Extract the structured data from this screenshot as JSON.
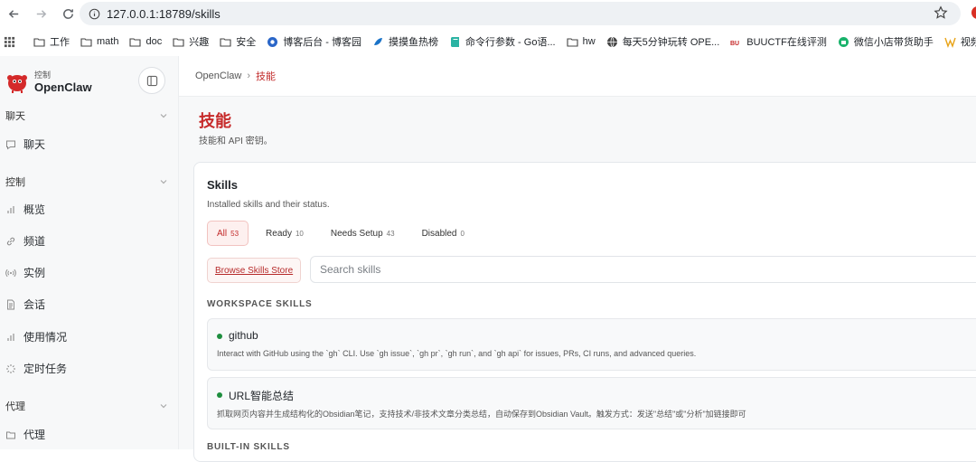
{
  "browser": {
    "url": "127.0.0.1:18789/skills",
    "bookmarks": [
      {
        "label": "工作",
        "icon": "folder-icon"
      },
      {
        "label": "math",
        "icon": "folder-icon"
      },
      {
        "label": "doc",
        "icon": "folder-icon"
      },
      {
        "label": "兴趣",
        "icon": "folder-icon"
      },
      {
        "label": "安全",
        "icon": "folder-icon"
      },
      {
        "label": "博客后台 - 博客园",
        "icon": "blog-icon"
      },
      {
        "label": "摸摸鱼热榜",
        "icon": "fish-icon"
      },
      {
        "label": "命令行参数 - Go语...",
        "icon": "book-icon"
      },
      {
        "label": "hw",
        "icon": "folder-icon"
      },
      {
        "label": "每天5分钟玩转 OPE...",
        "icon": "globe-icon"
      },
      {
        "label": "BUUCTF在线评测",
        "icon": "ctf-icon"
      },
      {
        "label": "微信小店带货助手",
        "icon": "shop-icon"
      },
      {
        "label": "视频号助手",
        "icon": "video-icon"
      }
    ]
  },
  "brand": {
    "small": "控制",
    "name": "OpenClaw"
  },
  "sidebar": {
    "groups": [
      {
        "label": "聊天",
        "items": [
          {
            "label": "聊天",
            "icon": "chat-icon"
          }
        ]
      },
      {
        "label": "控制",
        "items": [
          {
            "label": "概览",
            "icon": "bar-chart-icon"
          },
          {
            "label": "频道",
            "icon": "link-icon"
          },
          {
            "label": "实例",
            "icon": "broadcast-icon"
          },
          {
            "label": "会话",
            "icon": "document-icon"
          },
          {
            "label": "使用情况",
            "icon": "bar-chart-icon"
          },
          {
            "label": "定时任务",
            "icon": "loader-icon"
          }
        ]
      },
      {
        "label": "代理",
        "items": [
          {
            "label": "代理",
            "icon": "folder-icon"
          }
        ]
      }
    ]
  },
  "breadcrumb": {
    "home": "OpenClaw",
    "sep": "›",
    "current": "技能"
  },
  "page": {
    "title": "技能",
    "subtitle": "技能和 API 密钥。"
  },
  "card": {
    "title": "Skills",
    "subtitle": "Installed skills and their status.",
    "tabs": [
      {
        "label": "All",
        "count": "53"
      },
      {
        "label": "Ready",
        "count": "10"
      },
      {
        "label": "Needs Setup",
        "count": "43"
      },
      {
        "label": "Disabled",
        "count": "0"
      }
    ],
    "store_button": "Browse Skills Store",
    "search_placeholder": "Search skills",
    "workspace_label": "WORKSPACE SKILLS",
    "skills": [
      {
        "name": "github",
        "desc": "Interact with GitHub using the `gh` CLI. Use `gh issue`, `gh pr`, `gh run`, and `gh api` for issues, PRs, CI runs, and advanced queries."
      },
      {
        "name": "URL智能总结",
        "desc": "抓取网页内容并生成结构化的Obsidian笔记，支持技术/非技术文章分类总结，自动保存到Obsidian Vault。触发方式：发送\"总结\"或\"分析\"加链接即可"
      }
    ],
    "builtin_label": "BUILT-IN SKILLS"
  },
  "colors": {
    "accent": "#c62a2a",
    "ready_dot": "#1e8e3e"
  }
}
